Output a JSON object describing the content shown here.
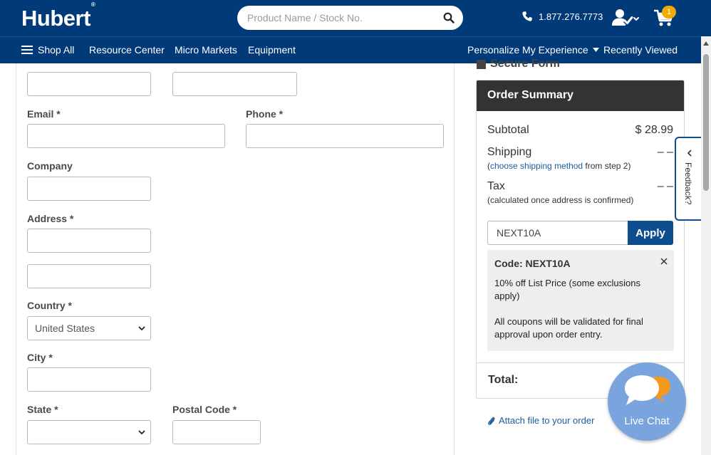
{
  "header": {
    "logo": "Hubert",
    "logo_mark": "®",
    "search_placeholder": "Product Name / Stock No.",
    "phone": "1.877.276.7773",
    "cart_count": "1"
  },
  "nav": {
    "shop_all": "Shop All",
    "items": [
      "Resource Center",
      "Micro Markets",
      "Equipment"
    ],
    "personalize": "Personalize My Experience",
    "recently_viewed": "Recently Viewed"
  },
  "form": {
    "email_label": "Email *",
    "phone_label": "Phone *",
    "company_label": "Company",
    "address_label": "Address *",
    "country_label": "Country *",
    "country_value": "United States",
    "city_label": "City *",
    "state_label": "State *",
    "postal_label": "Postal Code *"
  },
  "summary": {
    "secure_label": "Secure Form",
    "title": "Order Summary",
    "subtotal_label": "Subtotal",
    "subtotal_value": "$ 28.99",
    "shipping_label": "Shipping",
    "shipping_value": "– –",
    "shipping_note_open": "(",
    "shipping_link": "choose shipping method",
    "shipping_note_rest": " from step 2)",
    "tax_label": "Tax",
    "tax_value": "– –",
    "tax_note": "(calculated once address is confirmed)",
    "coupon_value": "NEXT10A",
    "apply_label": "Apply",
    "coupon_code": "Code: NEXT10A",
    "coupon_desc": "10% off List Price (some exclusions apply)",
    "coupon_note": "All coupons will be validated for final approval upon order entry.",
    "total_label": "Total:"
  },
  "attach_label": "Attach file to your order",
  "feedback_label": "Feedback?",
  "livechat_label": "Live Chat",
  "colors": {
    "brand_navy": "#003a78",
    "accent_blue": "#0e4e8e",
    "badge_orange": "#f2a900",
    "chat_blue": "#7aa4de"
  }
}
